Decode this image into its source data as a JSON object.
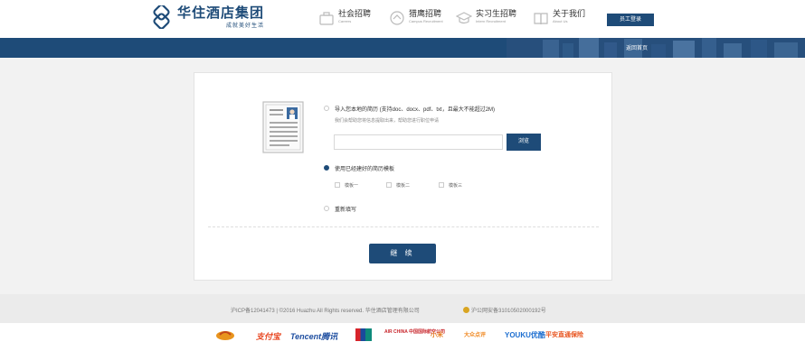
{
  "header": {
    "logo_title": "华住酒店集团",
    "logo_slogan": "成就美好生活",
    "nav": [
      {
        "label": "社会招聘",
        "sub": "Careers",
        "icon": "briefcase-icon"
      },
      {
        "label": "猎鹰招聘",
        "sub": "Campus Recruitment",
        "icon": "falcon-icon"
      },
      {
        "label": "实习生招聘",
        "sub": "Intern Recruitment",
        "icon": "graduation-cap-icon"
      },
      {
        "label": "关于我们",
        "sub": "About Us",
        "icon": "book-icon"
      }
    ],
    "staff_login": "员工登录"
  },
  "banner": {
    "return_home": "返回首页"
  },
  "form": {
    "option_import_label": "导入您本地的简历 (支持doc、docx、pdf、txt，且最大不能超过2M)",
    "option_import_hint": "我们会帮助您将信息提取出来，帮助您进行职位申请",
    "file_value": "",
    "browse_label": "浏览",
    "option_template_label": "使用已经建好的简历模板",
    "templates": [
      "模板一",
      "模板二",
      "模板三"
    ],
    "option_new_label": "重新填写",
    "selected_option": "template",
    "continue_label": "继 续"
  },
  "footer": {
    "copyright": "沪ICP备12041473 | ©2016 Huazhu All Rights reserved. 华住酒店管理有限公司",
    "police": "沪公网安备31010502000192号"
  },
  "partners": [
    "",
    "支付宝",
    "Tencent腾讯",
    "",
    "AIR CHINA 中国国际航空公司",
    "小米",
    "大众点评",
    "YOUKU优酷",
    "平安直通保险"
  ],
  "colors": {
    "primary": "#1e4b78",
    "background": "#f2f2f2"
  }
}
